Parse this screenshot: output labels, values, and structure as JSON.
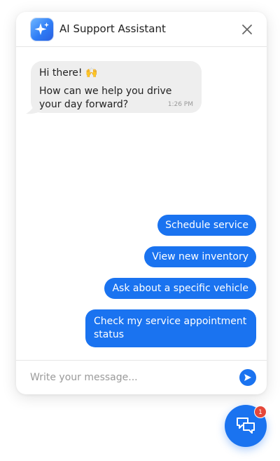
{
  "header": {
    "title": "AI Support Assistant",
    "logo_icon": "sparkle-icon",
    "close_icon": "close-icon"
  },
  "bot_message": {
    "greeting": "Hi there! 🙌",
    "text": "How can we help you drive your day forward?",
    "time": "1:26 PM"
  },
  "quick_replies": [
    {
      "label": "Schedule service"
    },
    {
      "label": "View new inventory"
    },
    {
      "label": "Ask about a specific vehicle"
    },
    {
      "label": "Check my service appointment status"
    }
  ],
  "composer": {
    "placeholder": "Write your message...",
    "value": "",
    "send_icon": "send-icon"
  },
  "launcher": {
    "icon": "chat-bubbles-icon",
    "badge_count": "1"
  },
  "colors": {
    "accent": "#1a73f0",
    "bot_bubble": "#eeeeee",
    "badge": "#e5473a"
  }
}
